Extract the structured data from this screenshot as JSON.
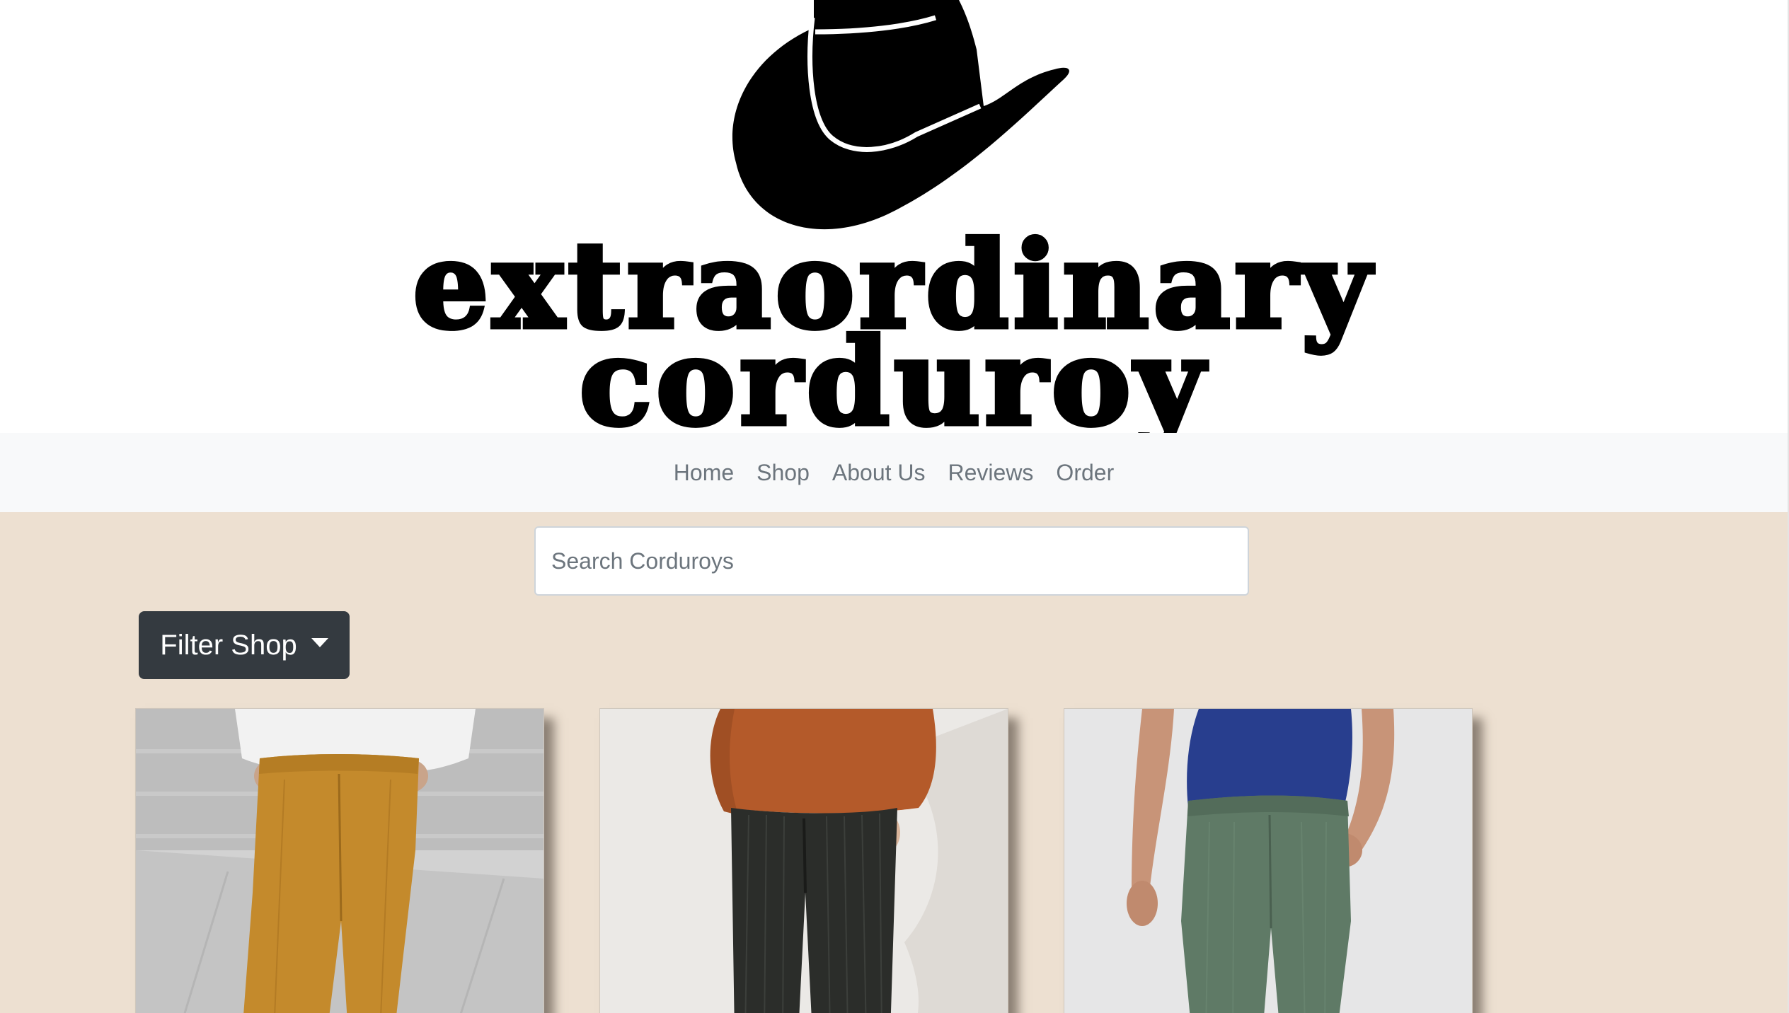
{
  "brand": {
    "logo_line1": "extraordinary",
    "logo_line2": "corduroy",
    "logo_icon": "cowboy-hat-icon"
  },
  "navbar": {
    "items": [
      {
        "label": "Home"
      },
      {
        "label": "Shop"
      },
      {
        "label": "About Us"
      },
      {
        "label": "Reviews"
      },
      {
        "label": "Order"
      }
    ]
  },
  "search": {
    "placeholder": "Search Corduroys",
    "value": ""
  },
  "filter": {
    "label": "Filter Shop",
    "icon": "caret-down-icon"
  },
  "products": [
    {
      "image": "mustard-corduroy-pants-photo"
    },
    {
      "image": "black-corduroy-pants-photo"
    },
    {
      "image": "sage-green-corduroy-pants-photo"
    }
  ],
  "colors": {
    "navbar_bg": "#f8f9fa",
    "main_bg": "#ede0d1",
    "nav_link": "#6c757d",
    "filter_button_bg": "#343a40"
  }
}
